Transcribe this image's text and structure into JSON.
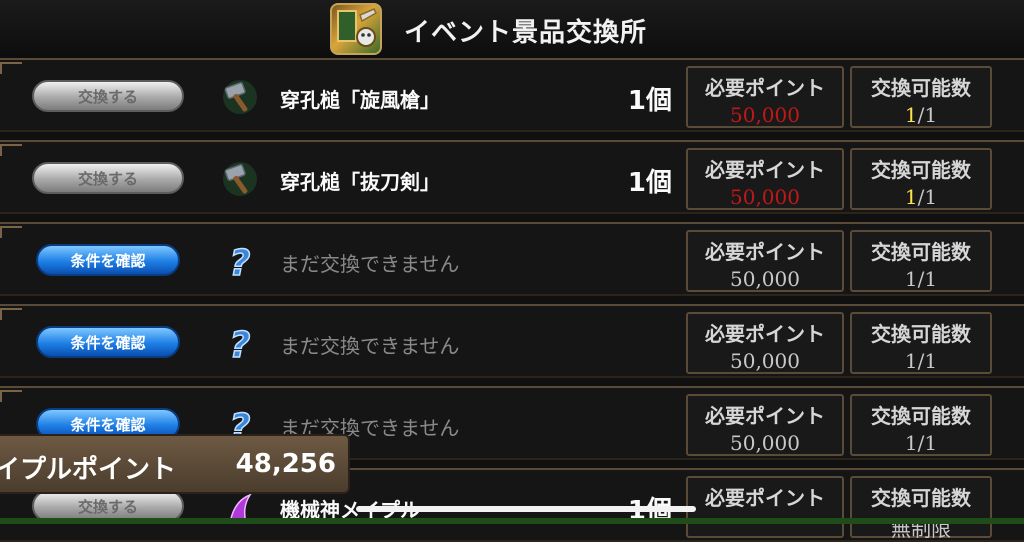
{
  "header": {
    "title": "イベント景品交換所",
    "icon": "event-shop-icon"
  },
  "labels": {
    "required_points": "必要ポイント",
    "exchange_count": "交換可能数"
  },
  "rows": [
    {
      "button": "交換する",
      "button_style": "gray",
      "icon": "hammer-icon",
      "name": "穿孔槌「旋風槍」",
      "quantity": "1個",
      "points": "50,000",
      "points_color": "#c01818",
      "count_used": "1",
      "count_total": "/1"
    },
    {
      "button": "交換する",
      "button_style": "gray",
      "icon": "hammer-icon",
      "name": "穿孔槌「抜刀剣」",
      "quantity": "1個",
      "points": "50,000",
      "points_color": "#c01818",
      "count_used": "1",
      "count_total": "/1"
    },
    {
      "button": "条件を確認",
      "button_style": "blue",
      "icon": "question-icon",
      "name": "まだ交換できません",
      "quantity": "",
      "points": "50,000",
      "count": "1/1"
    },
    {
      "button": "条件を確認",
      "button_style": "blue",
      "icon": "question-icon",
      "name": "まだ交換できません",
      "quantity": "",
      "points": "50,000",
      "count": "1/1"
    },
    {
      "button": "条件を確認",
      "button_style": "blue",
      "icon": "question-icon",
      "name": "まだ交換できません",
      "quantity": "",
      "points": "50,000",
      "count": "1/1"
    },
    {
      "button": "交換する",
      "button_style": "gray",
      "icon": "purple-item-icon",
      "name": "機械神メイプル",
      "quantity": "1個",
      "points": "",
      "count": "無制限"
    }
  ],
  "points_banner": {
    "label": "イプルポイント",
    "value": "48,256"
  },
  "colors": {
    "accent_gold": "#c7a25b",
    "required_red": "#c01818",
    "count_yellow": "#ffe24a",
    "button_blue": "#1e7fe6"
  }
}
